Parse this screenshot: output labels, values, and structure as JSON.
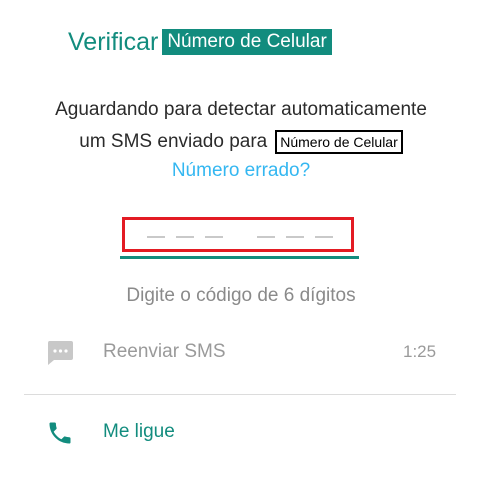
{
  "header": {
    "title_prefix": "Verificar",
    "title_highlight": "Número de Celular"
  },
  "description": {
    "line1": "Aguardando para detectar automaticamente",
    "line2": "um SMS enviado para",
    "phone_placeholder": "Número de Celular"
  },
  "wrong_number_link": "Número errado?",
  "code_input": {
    "digits_entered": "",
    "digit_count": 6
  },
  "hint": "Digite o código de 6 dígitos",
  "actions": {
    "resend": {
      "label": "Reenviar SMS",
      "timer": "1:25",
      "icon": "sms-icon"
    },
    "call": {
      "label": "Me ligue",
      "icon": "phone-icon"
    }
  },
  "colors": {
    "primary": "#128c7e",
    "link": "#34b7f1",
    "highlight_border": "#e31b23",
    "muted": "#9a9a9a"
  }
}
